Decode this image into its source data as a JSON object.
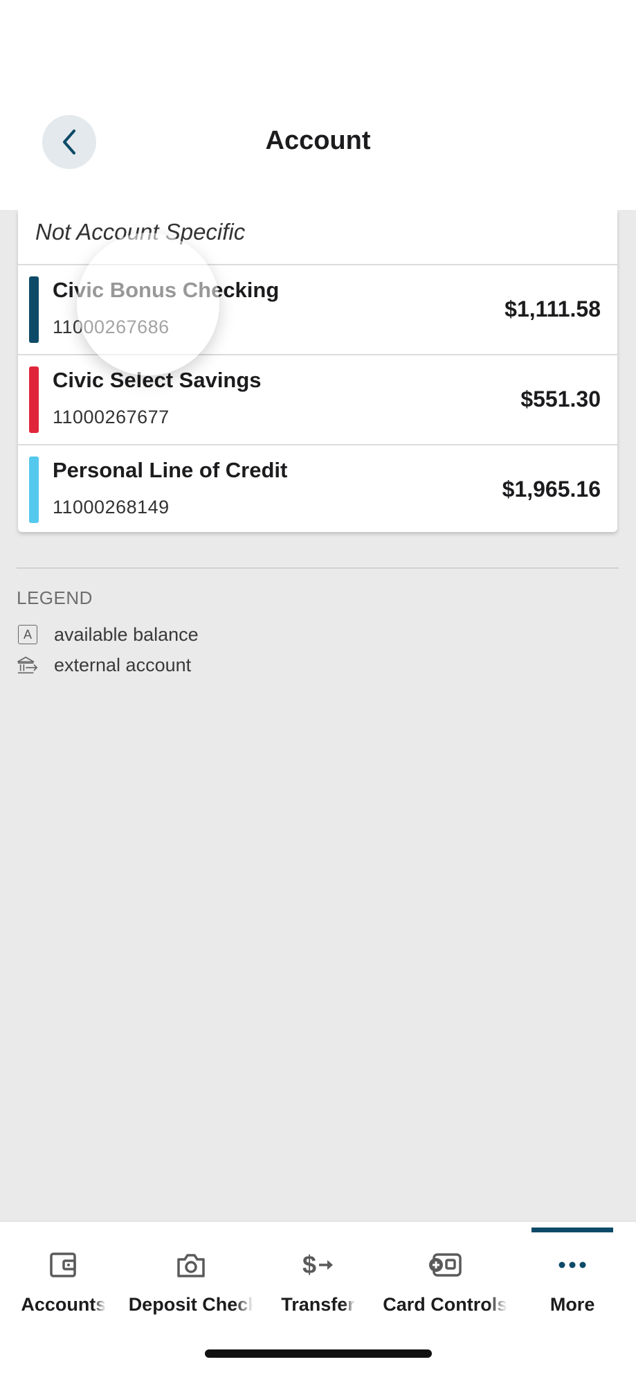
{
  "header": {
    "title": "Account"
  },
  "account_list": {
    "not_specific_label": "Not Account Specific",
    "accounts": [
      {
        "name": "Civic Bonus Checking",
        "number": "11000267686",
        "balance": "$1,111.58",
        "color": "#0d4a68"
      },
      {
        "name": "Civic Select Savings",
        "number": "11000267677",
        "balance": "$551.30",
        "color": "#e0253a"
      },
      {
        "name": "Personal Line of Credit",
        "number": "11000268149",
        "balance": "$1,965.16",
        "color": "#55c8ee"
      }
    ]
  },
  "legend": {
    "title": "LEGEND",
    "items": [
      {
        "icon": "available-balance-icon",
        "glyph": "A",
        "label": "available balance"
      },
      {
        "icon": "external-account-icon",
        "label": "external account"
      }
    ]
  },
  "tabbar": {
    "tabs": [
      {
        "label": "Accounts",
        "icon": "wallet-icon"
      },
      {
        "label": "Deposit Checks",
        "icon": "camera-icon"
      },
      {
        "label": "Transfer",
        "icon": "transfer-icon"
      },
      {
        "label": "Card Controls",
        "icon": "card-controls-icon"
      },
      {
        "label": "More",
        "icon": "more-icon",
        "active": true
      }
    ],
    "active_color": "#0d4a68"
  }
}
